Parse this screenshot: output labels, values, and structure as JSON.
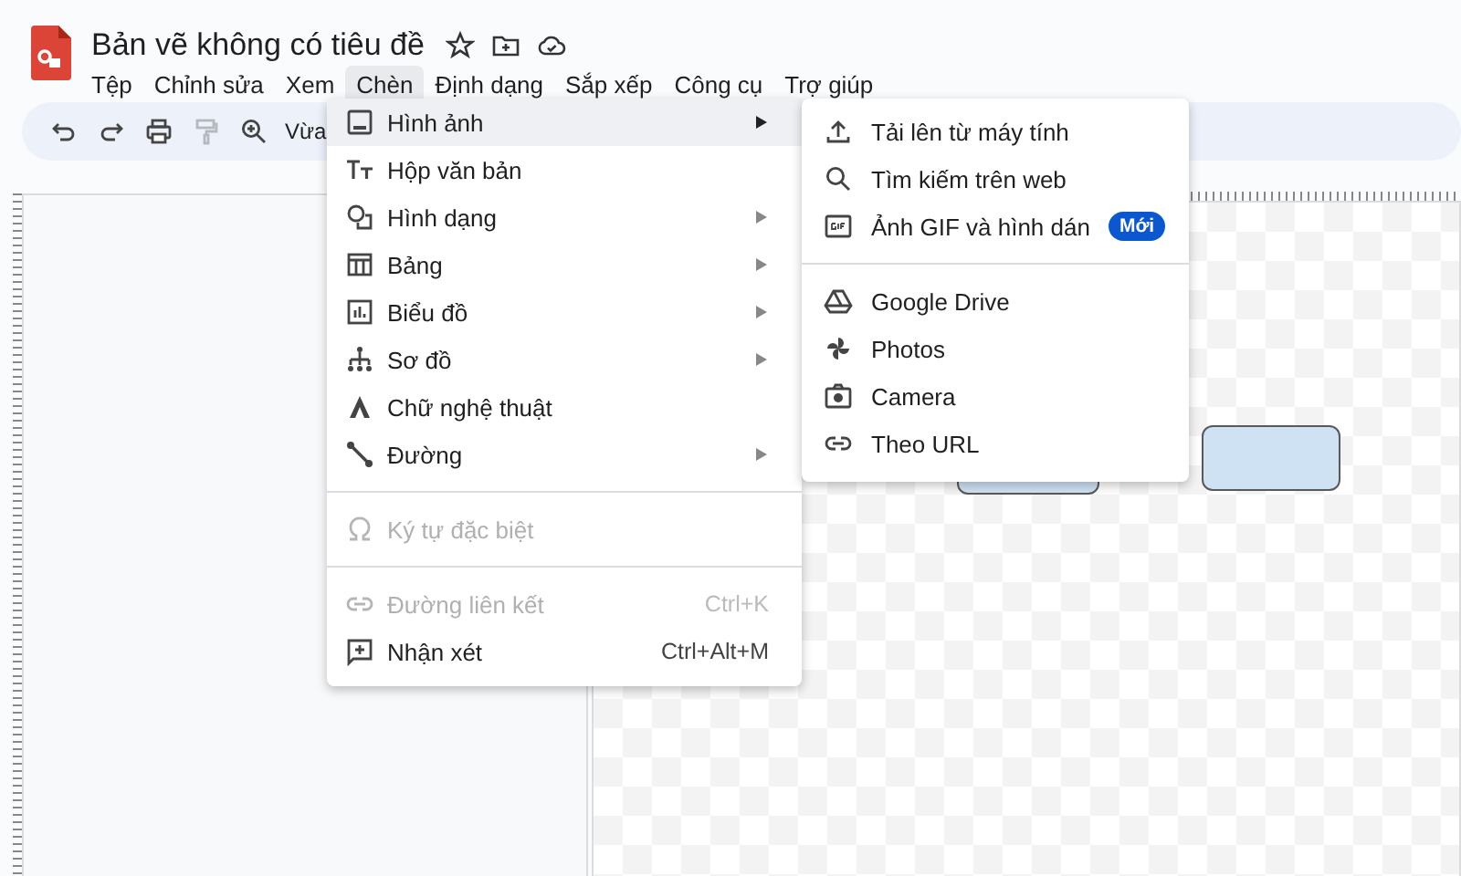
{
  "document": {
    "title": "Bản vẽ không có tiêu đề"
  },
  "menu_bar": [
    {
      "label": "Tệp",
      "selected": false
    },
    {
      "label": "Chỉnh sửa",
      "selected": false
    },
    {
      "label": "Xem",
      "selected": false
    },
    {
      "label": "Chèn",
      "selected": true
    },
    {
      "label": "Định dạng",
      "selected": false
    },
    {
      "label": "Sắp xếp",
      "selected": false
    },
    {
      "label": "Công cụ",
      "selected": false
    },
    {
      "label": "Trợ giúp",
      "selected": false
    }
  ],
  "toolbar": {
    "buttons": [
      {
        "kind": "undo",
        "disabled": false
      },
      {
        "kind": "redo",
        "disabled": false
      },
      {
        "kind": "print",
        "disabled": false
      },
      {
        "kind": "paint_format",
        "disabled": true
      },
      {
        "kind": "zoom",
        "disabled": false
      }
    ],
    "zoom_label": "Vừa"
  },
  "canvas": {
    "shapes": [
      {
        "kind": "rounded_rect"
      },
      {
        "kind": "rounded_rect"
      }
    ]
  },
  "insert_menu": {
    "groups": [
      [
        {
          "label": "Hình ảnh",
          "kind": "image",
          "submenu": true,
          "selected": true,
          "disabled": false
        },
        {
          "label": "Hộp văn bản",
          "kind": "textbox",
          "submenu": false,
          "selected": false,
          "disabled": false
        },
        {
          "label": "Hình dạng",
          "kind": "shape",
          "submenu": true,
          "selected": false,
          "disabled": false
        },
        {
          "label": "Bảng",
          "kind": "table",
          "submenu": true,
          "selected": false,
          "disabled": false
        },
        {
          "label": "Biểu đồ",
          "kind": "chart",
          "submenu": true,
          "selected": false,
          "disabled": false
        },
        {
          "label": "Sơ đồ",
          "kind": "diagram",
          "submenu": true,
          "selected": false,
          "disabled": false
        },
        {
          "label": "Chữ nghệ thuật",
          "kind": "wordart",
          "submenu": false,
          "selected": false,
          "disabled": false
        },
        {
          "label": "Đường",
          "kind": "line",
          "submenu": true,
          "selected": false,
          "disabled": false
        }
      ],
      [
        {
          "label": "Ký tự đặc biệt",
          "kind": "omega",
          "submenu": false,
          "selected": false,
          "disabled": true
        }
      ],
      [
        {
          "label": "Đường liên kết",
          "kind": "link",
          "submenu": false,
          "selected": false,
          "disabled": true,
          "shortcut": "Ctrl+K"
        },
        {
          "label": "Nhận xét",
          "kind": "comment",
          "submenu": false,
          "selected": false,
          "disabled": false,
          "shortcut": "Ctrl+Alt+M"
        }
      ]
    ]
  },
  "image_submenu": {
    "groups": [
      [
        {
          "label": "Tải lên từ máy tính",
          "kind": "upload"
        },
        {
          "label": "Tìm kiếm trên web",
          "kind": "search"
        },
        {
          "label": "Ảnh GIF và hình dán",
          "kind": "gif",
          "badge": "Mới"
        }
      ],
      [
        {
          "label": "Google Drive",
          "kind": "drive"
        },
        {
          "label": "Photos",
          "kind": "pinwheel"
        },
        {
          "label": "Camera",
          "kind": "camera"
        },
        {
          "label": "Theo URL",
          "kind": "link"
        }
      ]
    ]
  }
}
